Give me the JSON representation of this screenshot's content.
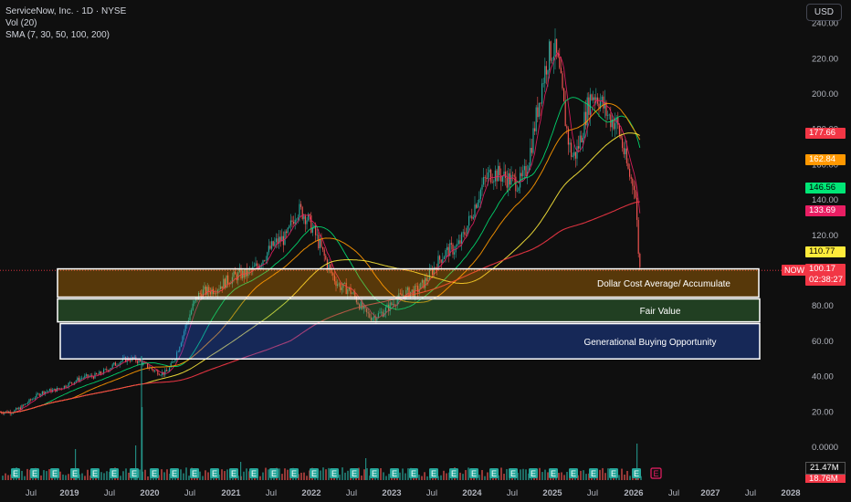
{
  "legend": {
    "title": "ServiceNow, Inc. · 1D · NYSE",
    "vol": "Vol (20)",
    "sma": "SMA (7, 30, 50, 100, 200)"
  },
  "currency_button": "USD",
  "colors": {
    "background": "#0f0f0f",
    "candle_up": "#26a69a",
    "candle_down": "#ef5350",
    "sma7": "#e91e63",
    "sma30": "#00e676",
    "sma50": "#ff9800",
    "sma100": "#ffeb3b",
    "sma200": "#f23645",
    "earnings_badge": "#26a69a"
  },
  "price_tags": [
    {
      "value": "177.66",
      "bg": "#f23645",
      "fg": "#ffffff",
      "price": 177.66
    },
    {
      "value": "162.84",
      "bg": "#ff9800",
      "fg": "#ffffff",
      "price": 162.84
    },
    {
      "value": "146.56",
      "bg": "#00e676",
      "fg": "#000000",
      "price": 146.56
    },
    {
      "value": "133.69",
      "bg": "#e91e63",
      "fg": "#ffffff",
      "price": 133.69
    },
    {
      "value": "110.77",
      "bg": "#ffeb3b",
      "fg": "#000000",
      "price": 110.77
    }
  ],
  "now_tag": {
    "label": "NOW",
    "price": "100.17",
    "countdown": "02:38:27",
    "value": 100.17
  },
  "volume_tags": {
    "v1": "21.47M",
    "v2": "18.76M"
  },
  "earnings_marker": "E",
  "chart_data": {
    "type": "line",
    "subtype": "candlestick",
    "title": "ServiceNow, Inc. · 1D · NYSE",
    "ylim": [
      0,
      240
    ],
    "yticks": [
      "240.00",
      "220.00",
      "200.00",
      "180.00",
      "160.00",
      "140.00",
      "120.00",
      "100.00",
      "80.00",
      "60.00",
      "40.00",
      "20.00",
      "0.0000"
    ],
    "xticks": [
      "Jul",
      "2019",
      "Jul",
      "2020",
      "Jul",
      "2021",
      "Jul",
      "2022",
      "Jul",
      "2023",
      "Jul",
      "2024",
      "Jul",
      "2025",
      "Jul",
      "2026",
      "Jul",
      "2027",
      "Jul",
      "2028"
    ],
    "x": [
      "2018-04",
      "2018-10",
      "2019-04",
      "2019-10",
      "2020-03",
      "2020-09",
      "2021-03",
      "2021-09",
      "2021-11",
      "2022-06",
      "2022-10",
      "2023-04",
      "2023-10",
      "2024-04",
      "2024-08",
      "2025-01",
      "2025-04",
      "2025-07",
      "2025-10",
      "2026-01",
      "2026-02"
    ],
    "series": [
      {
        "values": [
          20,
          32,
          40,
          50,
          42,
          88,
          98,
          118,
          134,
          90,
          74,
          88,
          112,
          155,
          150,
          225,
          165,
          200,
          185,
          150,
          100.17
        ]
      }
    ],
    "zones": [
      {
        "label": "Dollar Cost Average/ Accumulate",
        "low": 85,
        "high": 101,
        "color": "#ff9800"
      },
      {
        "label": "Fair Value",
        "low": 71,
        "high": 84,
        "color": "#4caf50"
      },
      {
        "label": "Generational Buying Opportunity",
        "low": 50,
        "high": 70,
        "color": "#2962ff"
      }
    ],
    "grid": false,
    "legend_position": "top-left"
  }
}
